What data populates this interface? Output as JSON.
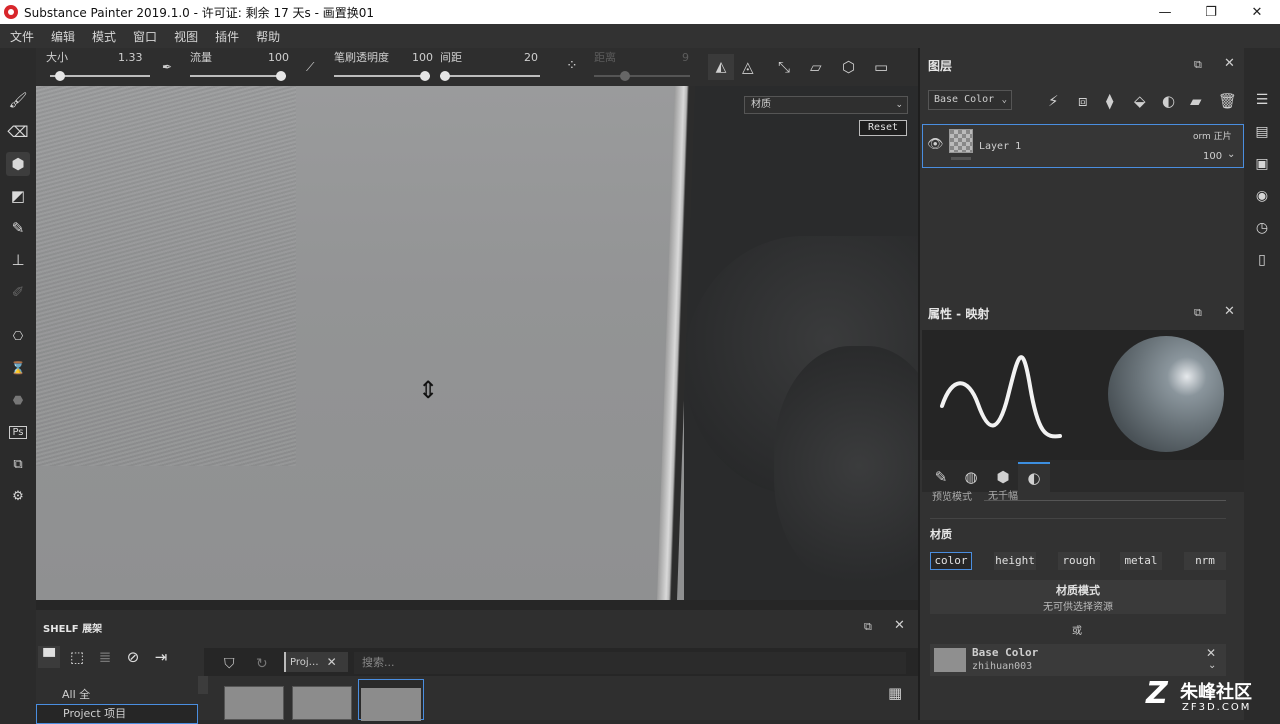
{
  "window": {
    "title": "Substance Painter 2019.1.0 - 许可证: 剩余 17 天s - 画置换01",
    "controls": [
      "—",
      "❐",
      "✕"
    ]
  },
  "menu": [
    "文件",
    "编辑",
    "模式",
    "窗口",
    "视图",
    "插件",
    "帮助"
  ],
  "tool_options": {
    "size_label": "大小",
    "size_value": "1.33",
    "flow_label": "流量",
    "flow_value": "100",
    "opacity_label": "笔刷透明度",
    "opacity_value": "100",
    "spacing_label": "间距",
    "spacing_value": "20",
    "distance_label": "距离",
    "distance_value": "9",
    "progress": {
      "size": 0.06,
      "flow": 1.0,
      "opacity": 1.0,
      "spacing": 0.0,
      "distance": 0.3
    }
  },
  "viewport": {
    "material_select": "材质",
    "reset_label": "Reset",
    "cursor_icon": "move-vertical-icon"
  },
  "layers": {
    "title": "图层",
    "channel": "Base Color",
    "layer_name": "Layer 1",
    "blend": "orm 正片",
    "opacity": "100"
  },
  "properties": {
    "title": "属性 - 映射",
    "cutoff_label": "预览模式",
    "cutoff_value": "无千幅",
    "material_label": "材质",
    "channels": [
      "color",
      "height",
      "rough",
      "metal",
      "nrm"
    ],
    "selected_channel": "color",
    "material_mode_title": "材质模式",
    "material_mode_sub": "无可供选择资源",
    "or_label": "或",
    "base_color_title": "Base Color",
    "base_color_sub": "zhihuan003"
  },
  "shelf": {
    "title": "SHELF 展架",
    "tab_label": "Proj…",
    "search_placeholder": "搜索...",
    "items": [
      "All 全",
      "Project 项目"
    ]
  },
  "watermark": {
    "main": "朱峰社区",
    "sub": "ZF3D.COM"
  }
}
